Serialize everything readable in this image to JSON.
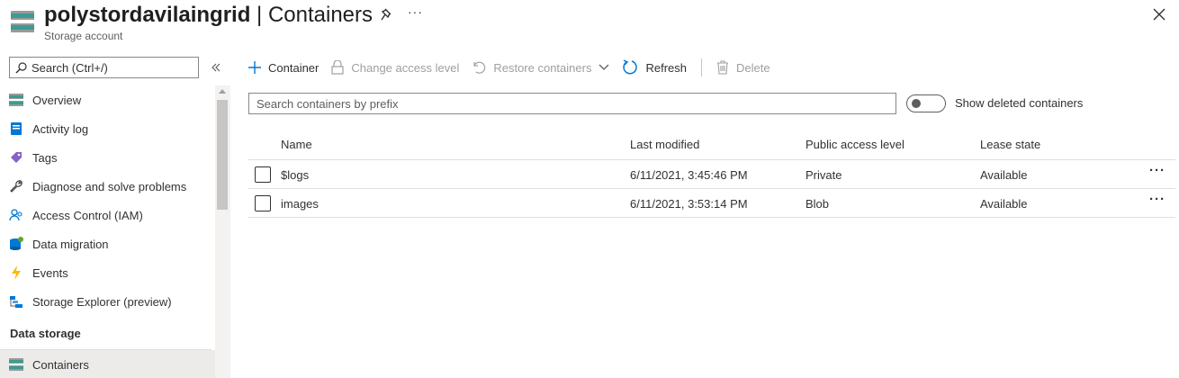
{
  "header": {
    "resource_name": "polystordavilaingrid",
    "separator": " | ",
    "blade_title": "Containers",
    "subtitle": "Storage account",
    "more_label": "···"
  },
  "sidebar": {
    "search_placeholder": "Search (Ctrl+/)",
    "items": [
      {
        "label": "Overview",
        "icon": "storage-overview-icon"
      },
      {
        "label": "Activity log",
        "icon": "activity-log-icon"
      },
      {
        "label": "Tags",
        "icon": "tag-icon"
      },
      {
        "label": "Diagnose and solve problems",
        "icon": "wrench-icon"
      },
      {
        "label": "Access Control (IAM)",
        "icon": "people-icon"
      },
      {
        "label": "Data migration",
        "icon": "data-migration-icon"
      },
      {
        "label": "Events",
        "icon": "lightning-icon"
      },
      {
        "label": "Storage Explorer (preview)",
        "icon": "storage-explorer-icon"
      }
    ],
    "section_data_storage": "Data storage",
    "active_item": {
      "label": "Containers",
      "icon": "containers-icon"
    }
  },
  "toolbar": {
    "container_label": "Container",
    "change_access_label": "Change access level",
    "restore_label": "Restore containers",
    "refresh_label": "Refresh",
    "delete_label": "Delete"
  },
  "filter": {
    "search_placeholder": "Search containers by prefix",
    "show_deleted_label": "Show deleted containers",
    "show_deleted_on": false
  },
  "table": {
    "columns": {
      "name": "Name",
      "last_modified": "Last modified",
      "public_access": "Public access level",
      "lease_state": "Lease state"
    },
    "rows": [
      {
        "name": "$logs",
        "last_modified": "6/11/2021, 3:45:46 PM",
        "public_access": "Private",
        "lease_state": "Available",
        "more": "···"
      },
      {
        "name": "images",
        "last_modified": "6/11/2021, 3:53:14 PM",
        "public_access": "Blob",
        "lease_state": "Available",
        "more": "···"
      }
    ]
  },
  "colors": {
    "accent": "#0078d4",
    "storage_teal": "#3c9b92",
    "disabled_text": "#a19f9d",
    "text": "#323130"
  }
}
